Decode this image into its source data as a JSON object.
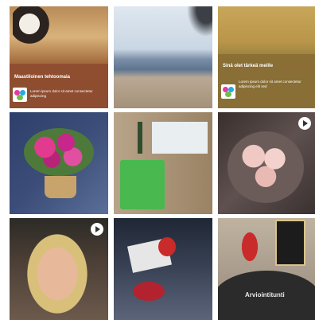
{
  "feed": {
    "tiles": [
      {
        "title": "Maastiloinen tehtoomaia",
        "subtitle": "Lorem ipsum dolor sit amet consectetur adipiscing"
      },
      {},
      {
        "title": "Sinä olet tärkeä meille",
        "subtitle": "Lorem ipsum dolor sit amet consectetur adipiscing elit sed"
      },
      {},
      {},
      {},
      {},
      {},
      {
        "overlay_text": "Arviointitunti"
      }
    ]
  }
}
